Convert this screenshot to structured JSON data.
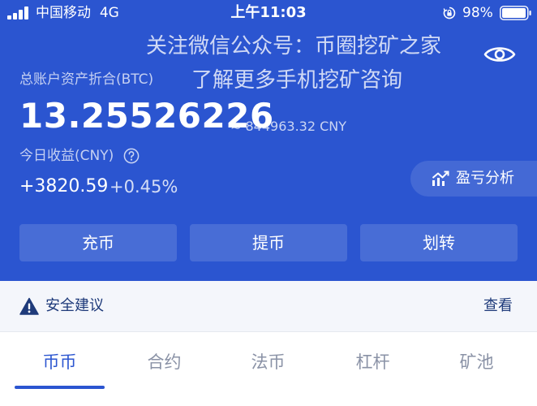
{
  "status_bar": {
    "carrier": "中国移动",
    "network": "4G",
    "time": "上午11:03",
    "battery": "98%"
  },
  "watermark": {
    "line1": "关注微信公众号：币圈挖矿之家",
    "line2": "了解更多手机挖矿咨询"
  },
  "account": {
    "total_label": "总账户资产折合(BTC)",
    "total_value": "13.25526226",
    "total_cny": "≈ 844963.32 CNY",
    "income_label": "今日收益(CNY)",
    "income_value": "+3820.59",
    "income_pct": "+0.45%"
  },
  "buttons": {
    "profit_loss": "盈亏分析",
    "deposit": "充币",
    "withdraw": "提币",
    "transfer": "划转"
  },
  "security": {
    "label": "安全建议",
    "view": "查看"
  },
  "tabs": [
    {
      "label": "币币",
      "active": true
    },
    {
      "label": "合约",
      "active": false
    },
    {
      "label": "法币",
      "active": false
    },
    {
      "label": "杠杆",
      "active": false
    },
    {
      "label": "矿池",
      "active": false
    }
  ],
  "colors": {
    "primary": "#2b55d0",
    "security_text": "#1e3a7a",
    "tab_inactive": "#8a92a6"
  },
  "icons": {
    "eye": "eye-icon",
    "help": "help-icon",
    "chart": "chart-icon",
    "warning": "warning-icon",
    "lock": "orientation-lock-icon",
    "battery": "battery-icon",
    "signal": "signal-icon"
  }
}
